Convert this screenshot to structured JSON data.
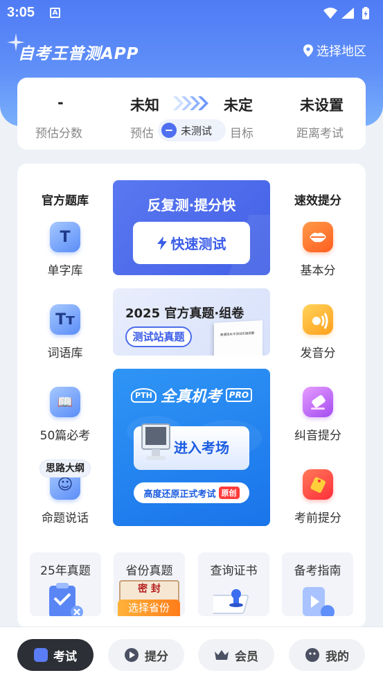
{
  "status_bar": {
    "time": "3:05",
    "notif_glyph": "A"
  },
  "header": {
    "title": "自考王普测APP",
    "region_label": "选择地区",
    "region_icon": "location-pin-icon"
  },
  "stats": {
    "score_value": "-",
    "score_label": "预估分数",
    "estimate_value": "未知",
    "estimate_label": "预估",
    "target_value": "未定",
    "target_label": "目标",
    "untested_label": "未测试",
    "countdown_value": "未设置",
    "countdown_label": "距离考试"
  },
  "left_column": {
    "heading": "官方题库",
    "items": [
      {
        "label": "单字库",
        "glyph": "T"
      },
      {
        "label": "词语库",
        "glyph": "Tт"
      },
      {
        "label": "50篇必考",
        "glyph": "📖"
      },
      {
        "label": "命题说话",
        "glyph": "☺",
        "badge": "思路大纲"
      }
    ]
  },
  "right_column": {
    "heading": "速效提分",
    "items": [
      {
        "label": "基本分"
      },
      {
        "label": "发音分"
      },
      {
        "label": "纠音提分"
      },
      {
        "label": "考前提分"
      }
    ]
  },
  "banner_quick": {
    "title": "反复测·提分快",
    "button": "快速测试"
  },
  "banner_papers": {
    "title": "2025 官方真题·组卷",
    "chip": "测试站真题",
    "book_text": "普通话水平测试实施纲要"
  },
  "banner_exam": {
    "logo": "PTH",
    "title": "全真机考",
    "pro": "PRO",
    "button": "进入考场",
    "strip": "高度还原正式考试",
    "strip_badge": "原创"
  },
  "tiles": [
    {
      "label": "25年真题"
    },
    {
      "label": "省份真题",
      "tag": "选择省份",
      "seal": "密 封"
    },
    {
      "label": "查询证书"
    },
    {
      "label": "备考指南"
    }
  ],
  "tabs": [
    {
      "label": "考试",
      "active": true
    },
    {
      "label": "提分",
      "active": false
    },
    {
      "label": "会员",
      "active": false
    },
    {
      "label": "我的",
      "active": false
    }
  ],
  "colors": {
    "brand_blue": "#4f7cf5",
    "accent_orange": "#ff7d1a",
    "tab_active": "#2d2f36"
  }
}
